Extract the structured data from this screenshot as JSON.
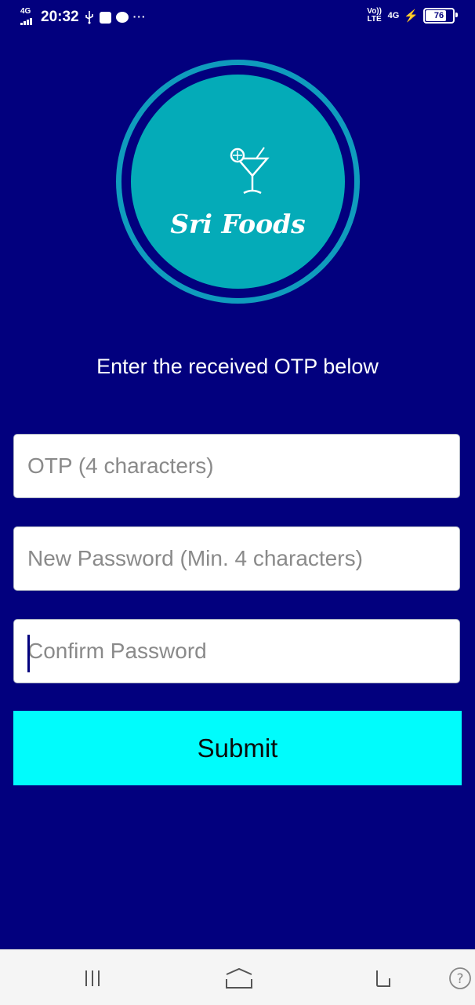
{
  "status_bar": {
    "network_left": "4G",
    "time": "20:32",
    "dots": "···",
    "volte": "Vo)) LTE",
    "network_right": "4G",
    "battery": "76"
  },
  "logo": {
    "brand": "Sri Foods",
    "icon": "cocktail-glass-icon",
    "colors": {
      "ring": "#0f9cbd",
      "inner": "#04abb8"
    }
  },
  "form": {
    "heading": "Enter the received OTP below",
    "otp_placeholder": "OTP (4 characters)",
    "new_password_placeholder": "New Password (Min. 4 characters)",
    "confirm_password_placeholder": "Confirm Password",
    "submit_label": "Submit"
  },
  "nav": {
    "icons": [
      "menu-icon",
      "home-icon",
      "back-icon",
      "help-icon"
    ]
  },
  "colors": {
    "background": "#02007e",
    "submit": "#00fcfc"
  }
}
